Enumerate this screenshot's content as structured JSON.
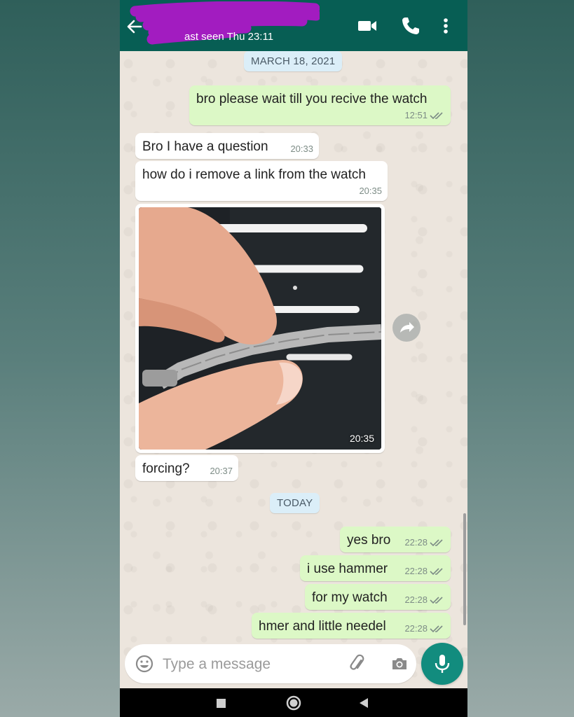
{
  "header": {
    "status": "ast seen Thu 23:11",
    "icons": [
      "back-arrow-icon",
      "video-call-icon",
      "phone-icon",
      "more-options-icon"
    ],
    "color": "#075e54"
  },
  "chips": {
    "date_past": "MARCH 18, 2021",
    "date_today": "TODAY"
  },
  "messages": [
    {
      "dir": "out",
      "text": "bro please wait till you recive the watch",
      "time": "12:51",
      "ticks": true
    },
    {
      "dir": "in",
      "text": "Bro I have a question",
      "time": "20:33"
    },
    {
      "dir": "in",
      "text": "how do i remove a link from the watch",
      "time": "20:35"
    },
    {
      "dir": "in",
      "type": "image",
      "time": "20:35"
    },
    {
      "dir": "in",
      "text": "forcing?",
      "time": "20:37"
    },
    {
      "dir": "out",
      "text": "yes bro",
      "time": "22:28",
      "ticks": true
    },
    {
      "dir": "out",
      "text": "i use hammer",
      "time": "22:28",
      "ticks": true
    },
    {
      "dir": "out",
      "text": "for my watch",
      "time": "22:28",
      "ticks": true
    },
    {
      "dir": "out",
      "text": "hmer and little needel",
      "time": "22:28",
      "ticks": true
    }
  ],
  "composer": {
    "placeholder": "Type a message",
    "icons": [
      "emoji-icon",
      "attach-icon",
      "camera-icon",
      "mic-icon"
    ]
  },
  "colors": {
    "outgoing_bubble": "#dcf8c6",
    "incoming_bubble": "#ffffff",
    "accent": "#128c7e",
    "read_ticks": "#7d8c86"
  }
}
